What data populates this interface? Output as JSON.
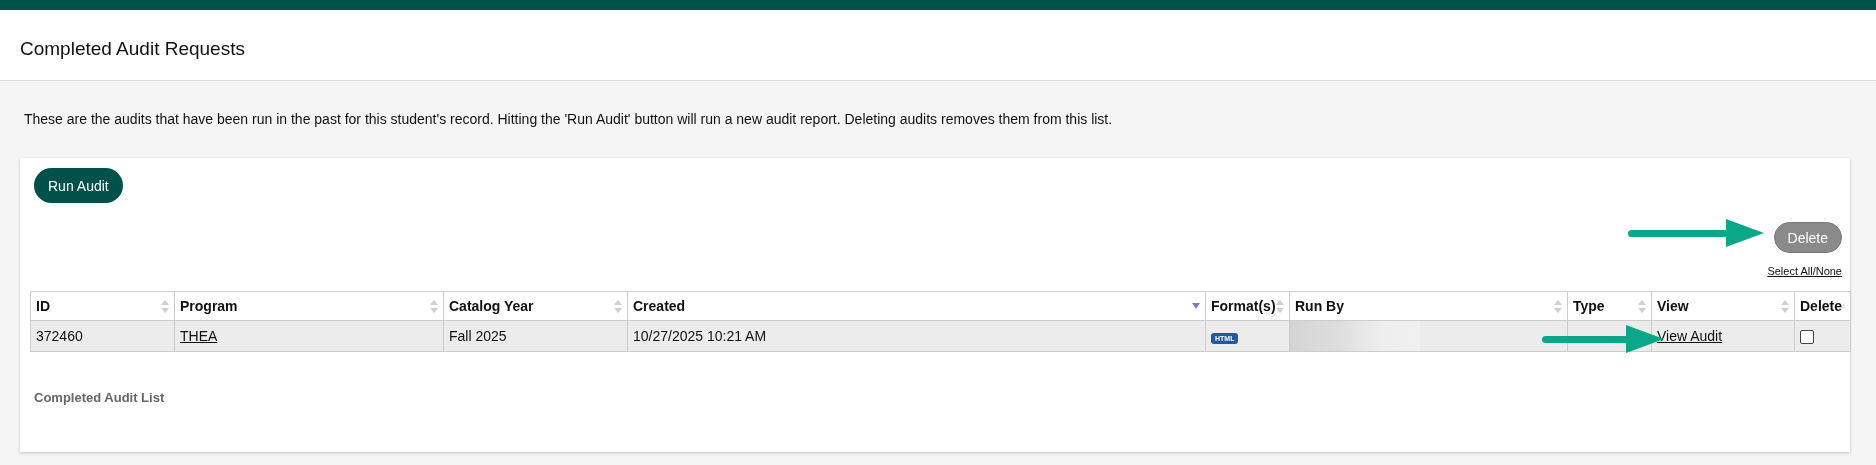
{
  "page_title": "Completed Audit Requests",
  "description": "These are the audits that have been run in the past for this student's record. Hitting the 'Run Audit' button will run a new audit report. Deleting audits removes them from this list.",
  "run_audit_button": "Run Audit",
  "delete_button": {
    "label": "Delete",
    "disabled": true
  },
  "select_all_link": "Select All/None",
  "table": {
    "columns": [
      {
        "label": "ID",
        "sorted": false
      },
      {
        "label": "Program",
        "sorted": false
      },
      {
        "label": "Catalog Year",
        "sorted": false
      },
      {
        "label": "Created",
        "sorted": true
      },
      {
        "label": "Format(s)",
        "sorted": false
      },
      {
        "label": "Run By",
        "sorted": false
      },
      {
        "label": "Type",
        "sorted": false
      },
      {
        "label": "View",
        "sorted": false
      },
      {
        "label": "Delete",
        "sorted": false
      }
    ],
    "rows": [
      {
        "id": "372460",
        "program": "THEA",
        "catalog_year": "Fall 2025",
        "created": "10/27/2025 10:21 AM",
        "format": "HTML",
        "view": "View Audit",
        "checked": false
      }
    ]
  },
  "footer_label": "Completed Audit List"
}
